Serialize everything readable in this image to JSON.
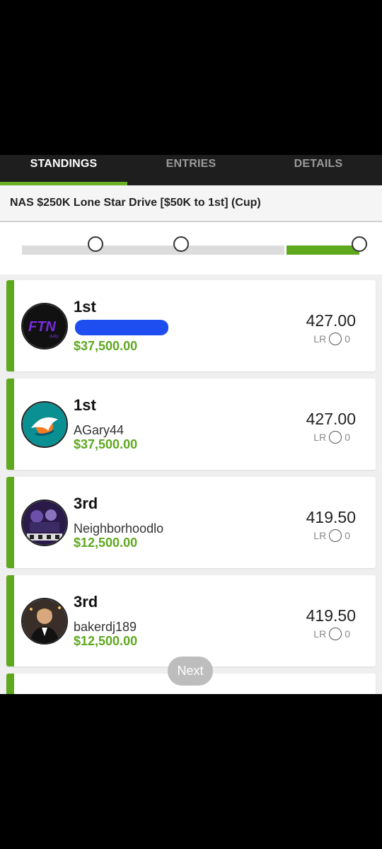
{
  "tabs": [
    {
      "label": "STANDINGS",
      "active": true
    },
    {
      "label": "ENTRIES",
      "active": false
    },
    {
      "label": "DETAILS",
      "active": false
    }
  ],
  "contest": {
    "title": "NAS $250K Lone Star Drive [$50K to 1st] (Cup)"
  },
  "progress": {
    "steps": 4,
    "current_step": 4
  },
  "entries": [
    {
      "rank": "1st",
      "username": "",
      "username_redacted": true,
      "prize": "$37,500.00",
      "score": "427.00",
      "lr_label": "LR",
      "lr_value": "0",
      "avatar": "ftn-logo"
    },
    {
      "rank": "1st",
      "username": "AGary44",
      "prize": "$37,500.00",
      "score": "427.00",
      "lr_label": "LR",
      "lr_value": "0",
      "avatar": "dolphins-logo"
    },
    {
      "rank": "3rd",
      "username": "Neighborhoodlo",
      "prize": "$12,500.00",
      "score": "419.50",
      "lr_label": "LR",
      "lr_value": "0",
      "avatar": "vikings-photo"
    },
    {
      "rank": "3rd",
      "username": "bakerdj189",
      "prize": "$12,500.00",
      "score": "419.50",
      "lr_label": "LR",
      "lr_value": "0",
      "avatar": "man-in-suit-photo"
    }
  ],
  "next_button": {
    "label": "Next"
  },
  "colors": {
    "accent_green": "#5ea81e",
    "tab_bar": "#1e1e1e",
    "redaction": "#1f4ef0"
  }
}
